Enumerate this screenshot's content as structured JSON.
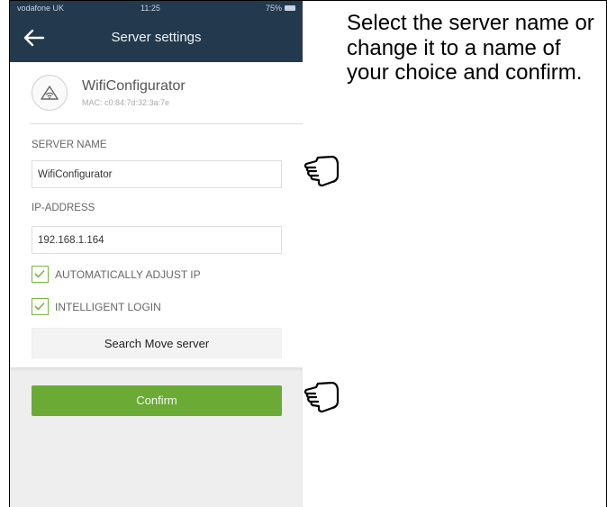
{
  "status_bar": {
    "carrier": "vodafone UK",
    "time": "11:25",
    "battery": "75%"
  },
  "nav": {
    "title": "Server settings",
    "back_icon": "arrow-left-icon"
  },
  "device": {
    "name": "WifiConfigurator",
    "mac": "MAC: c0:84:7d:32:3a:7e",
    "icon": "wifi-icon"
  },
  "server_name": {
    "label": "SERVER NAME",
    "value": "WifiConfigurator"
  },
  "ip_address": {
    "label": "IP-ADDRESS",
    "value": "192.168.1.164"
  },
  "options": [
    {
      "label": "AUTOMATICALLY ADJUST IP",
      "checked": true
    },
    {
      "label": "INTELLIGENT LOGIN",
      "checked": true
    }
  ],
  "search_button": {
    "label": "Search Move server"
  },
  "confirm_button": {
    "label": "Confirm",
    "color": "#6aaa35"
  },
  "instruction": "Select the server name or change it to a name of your choice and confirm.",
  "colors": {
    "header": "#23394d",
    "accent": "#7cb342"
  }
}
